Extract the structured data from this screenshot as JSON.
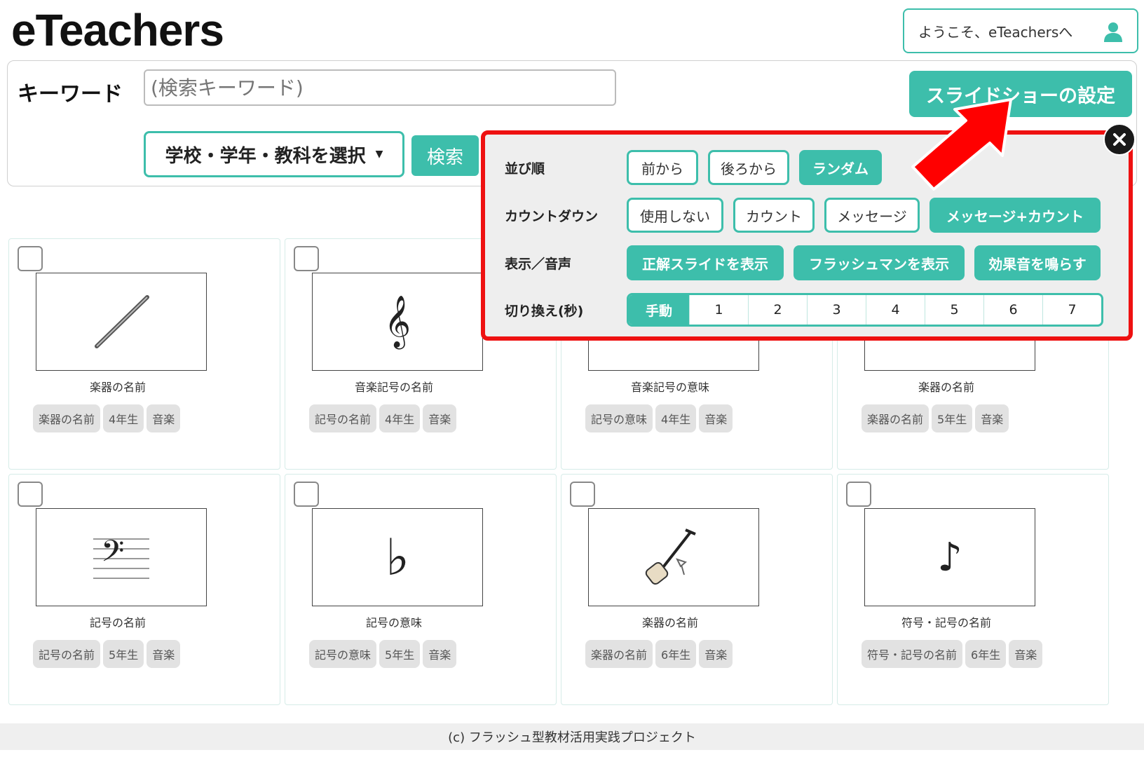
{
  "header": {
    "logo": "eTeachers",
    "welcome_text": "ようこそ、eTeachersへ",
    "user_icon": "user-icon"
  },
  "search": {
    "keyword_label": "キーワード",
    "keyword_placeholder": "(検索キーワード)",
    "select_label": "学校・学年・教科を選択",
    "search_label": "検索",
    "slideshow_label": "スライドショーの設定"
  },
  "popup": {
    "order": {
      "label": "並び順",
      "options": [
        "前から",
        "後ろから",
        "ランダム"
      ],
      "selected": "ランダム"
    },
    "countdown": {
      "label": "カウントダウン",
      "options": [
        "使用しない",
        "カウント",
        "メッセージ",
        "メッセージ+カウント"
      ],
      "selected": "メッセージ+カウント"
    },
    "display": {
      "label": "表示／音声",
      "options": [
        "正解スライドを表示",
        "フラッシュマンを表示",
        "効果音を鳴らす"
      ],
      "selected": [
        "正解スライドを表示",
        "フラッシュマンを表示",
        "効果音を鳴らす"
      ]
    },
    "switch": {
      "label": "切り換え(秒)",
      "options": [
        "手動",
        "1",
        "2",
        "3",
        "4",
        "5",
        "6",
        "7"
      ],
      "selected": "手動"
    },
    "close_icon": "close-icon"
  },
  "cards": [
    {
      "title": "楽器の名前",
      "tags": [
        "楽器の名前",
        "4年生",
        "音楽"
      ],
      "image": "flute-icon"
    },
    {
      "title": "音楽記号の名前",
      "tags": [
        "記号の名前",
        "4年生",
        "音楽"
      ],
      "image": "treble-clef-icon"
    },
    {
      "title": "音楽記号の意味",
      "tags": [
        "記号の意味",
        "4年生",
        "音楽"
      ],
      "image": "music-symbol-icon"
    },
    {
      "title": "楽器の名前",
      "tags": [
        "楽器の名前",
        "5年生",
        "音楽"
      ],
      "image": "instrument-icon"
    },
    {
      "title": "記号の名前",
      "tags": [
        "記号の名前",
        "5年生",
        "音楽"
      ],
      "image": "bass-clef-icon"
    },
    {
      "title": "記号の意味",
      "tags": [
        "記号の意味",
        "5年生",
        "音楽"
      ],
      "image": "flat-icon"
    },
    {
      "title": "楽器の名前",
      "tags": [
        "楽器の名前",
        "6年生",
        "音楽"
      ],
      "image": "shamisen-icon"
    },
    {
      "title": "符号・記号の名前",
      "tags": [
        "符号・記号の名前",
        "6年生",
        "音楽"
      ],
      "image": "eighth-note-icon"
    }
  ],
  "footer": {
    "text": "(c) フラッシュ型教材活用実践プロジェクト"
  },
  "colors": {
    "accent": "#3dbeab",
    "highlight": "#ee1111"
  }
}
